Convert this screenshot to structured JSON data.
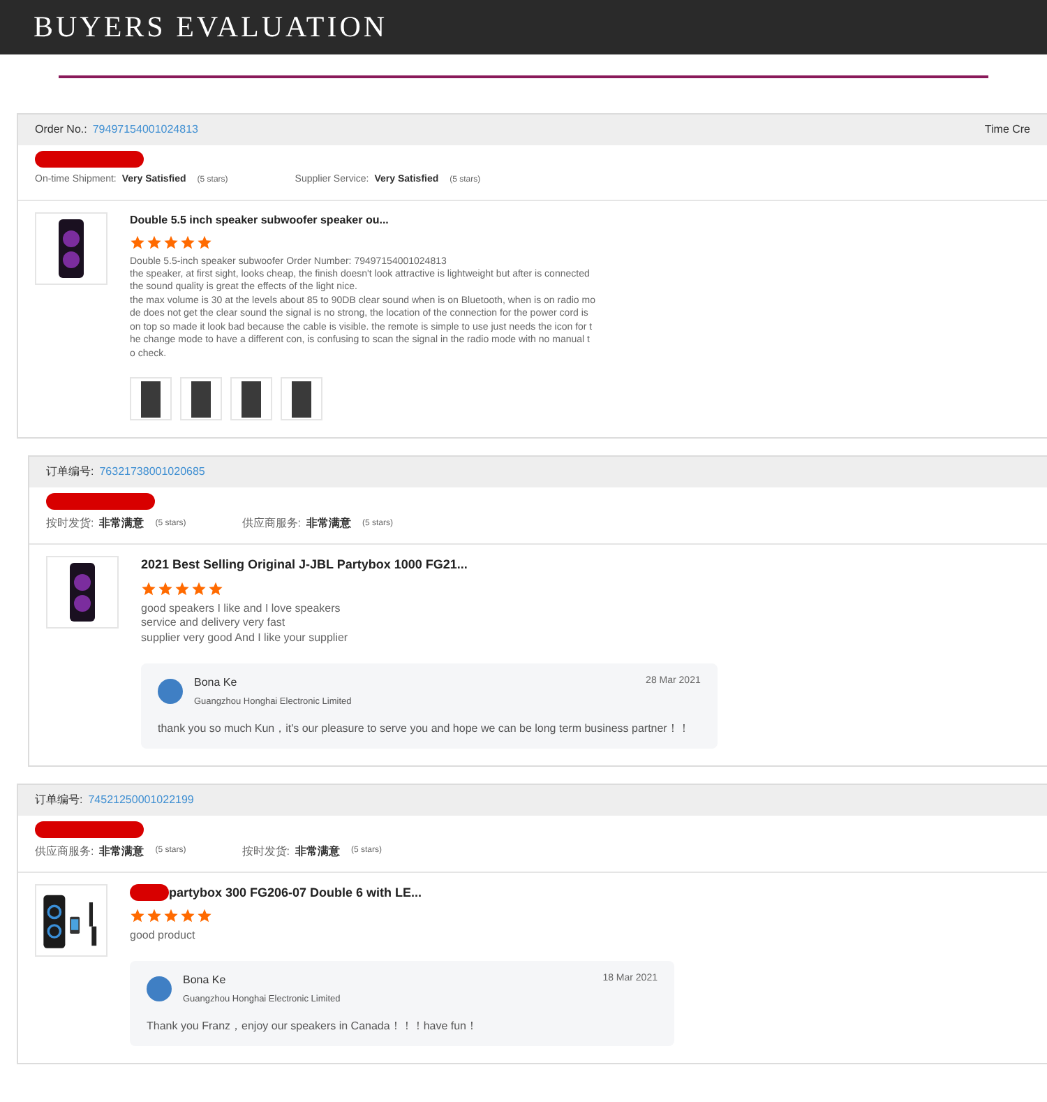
{
  "banner": {
    "title": "BUYERS EVALUATION"
  },
  "reviews": [
    {
      "order_label": "Order No.:",
      "order_no": "79497154001024813",
      "header_right": "Time Cre",
      "ratings": [
        {
          "label": "On-time Shipment:",
          "value": "Very Satisfied",
          "note": "(5 stars)"
        },
        {
          "label": "Supplier Service:",
          "value": "Very Satisfied",
          "note": "(5 stars)"
        }
      ],
      "product": {
        "title": "Double 5.5 inch speaker subwoofer speaker ou...",
        "title_redacted": false
      },
      "stars": 5,
      "text": [
        "Double 5.5-inch speaker subwoofer Order Number: 79497154001024813",
        "the speaker, at first sight, looks cheap, the finish doesn't look attractive is lightweight but after is connected",
        "the sound quality is great the effects of the light nice.",
        "the max volume is 30 at the levels about 85 to 90DB clear sound when is on Bluetooth, when is on radio mo",
        "de does not get the clear sound the signal is no strong, the location of the connection for the power cord is",
        "on top so made it look bad because the cable is visible. the remote is simple to use just needs the icon for t",
        "he change mode to have a different con, is confusing to scan the signal in the radio mode with no manual t",
        "o check."
      ],
      "photos": [
        {
          "kind": "photo"
        },
        {
          "kind": "photo"
        },
        {
          "kind": "photo"
        },
        {
          "kind": "photo"
        }
      ]
    },
    {
      "order_label": "订单编号:",
      "order_no": "76321738001020685",
      "ratings": [
        {
          "label": "按时发货:",
          "value": "非常满意",
          "note": "(5 stars)"
        },
        {
          "label": "供应商服务:",
          "value": "非常满意",
          "note": "(5 stars)"
        }
      ],
      "product": {
        "title": "2021 Best Selling Original J-JBL Partybox 1000 FG21...",
        "title_redacted": false
      },
      "stars": 5,
      "text": [
        "good speakers I like and I love speakers",
        "service and delivery very fast",
        "supplier very good And I like your supplier"
      ],
      "reply": {
        "name": "Bona Ke",
        "company": "Guangzhou Honghai Electronic Limited",
        "date": "28 Mar 2021",
        "text": "thank you so much Kun，it's our pleasure to serve you and hope we can be long term business partner！！"
      }
    },
    {
      "order_label": "订单编号:",
      "order_no": "74521250001022199",
      "ratings": [
        {
          "label": "供应商服务:",
          "value": "非常满意",
          "note": "(5 stars)"
        },
        {
          "label": "按时发货:",
          "value": "非常满意",
          "note": "(5 stars)"
        }
      ],
      "product": {
        "title": "partybox 300 FG206-07 Double 6 with LE...",
        "title_redacted": true
      },
      "stars": 5,
      "text": [
        "good product"
      ],
      "reply": {
        "name": "Bona Ke",
        "company": "Guangzhou Honghai Electronic Limited",
        "date": "18 Mar 2021",
        "text": "Thank you Franz，enjoy our speakers in Canada！！！have fun！"
      }
    }
  ]
}
